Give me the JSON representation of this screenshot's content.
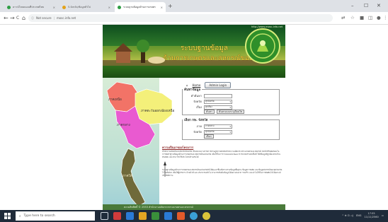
{
  "browser": {
    "tabs": [
      {
        "label": "ดาวน์โหลดแผนที่ประเทศไทย",
        "active": false,
        "color": "#2e9e44"
      },
      {
        "label": "5.จังหวัด/ข้อมูลทั่วไป",
        "active": false,
        "color": "#e3a21a"
      },
      {
        "label": "ระบบฐานข้อมูลด้านการเกษตร",
        "active": true,
        "color": "#2e9e44"
      }
    ],
    "new_tab": "+",
    "window_controls": [
      "–",
      "☐",
      "✕"
    ],
    "nav": {
      "back": "←",
      "forward": "→",
      "reload": "C",
      "home": "⌂"
    },
    "address": {
      "security": "Not secure",
      "url": "mosc.info.net"
    }
  },
  "site": {
    "banner": {
      "top_url": "http://www.mosc-info.net",
      "title_line1": "ระบบฐานข้อมูล",
      "title_line2": "ด้านการเกษตรและสหกรณ์ของจังหวัด"
    },
    "home_link": "Home",
    "admin_button": "Admin Login",
    "search_box": {
      "legend": "ค้นหาข้อมูล",
      "rows": [
        {
          "label": "คำค้นหา",
          "type": "input",
          "value": ""
        },
        {
          "label": "จังหวัด",
          "type": "select",
          "value": "ทุกจังหวัด"
        },
        {
          "label": "เรื่อง",
          "type": "select",
          "value": "ทุกเรื่อง"
        }
      ],
      "search_button": "ค้นหา",
      "advanced_button": "ค้นหาแบบระบุเงื่อนไข"
    },
    "select_box": {
      "legend": "เลือก กษ. จังหวัด",
      "rows": [
        {
          "label": "ภาค",
          "value": "ภาคกลาง"
        },
        {
          "label": "จังหวัด",
          "value": "ทุกจังหวัด"
        }
      ],
      "go_button": "เลือก"
    },
    "news": {
      "title": "ความเป็นมาของโครงการ",
      "paragraph1": "สำนักงานเกษตรและสหกรณ์จังหวัด เป็นหน่วยงานราชการส่วนภูมิภาคสังกัดสำนักงานปลัดกระทรวงเกษตรและสหกรณ์ มีหน้าที่รับผิดชอบในการจัดทำฐานข้อมูลด้านการเกษตรและสหกรณ์ของจังหวัด เพื่อใช้ในการวางแผนและพัฒนาการเกษตรระดับพื้นที่ ให้มีข้อมูลที่ถูกต้องครบถ้วน ทันสมัย และสามารถใช้ประโยชน์ร่วมกันได้",
      "paragraph2": "ระบบฐานข้อมูลด้านการเกษตรและสหกรณ์ของจังหวัดจึงได้พัฒนาขึ้นเพื่อรวบรวมข้อมูลพื้นฐาน ข้อมูลการผลิต และข้อมูลสหกรณ์ของทุกจังหวัดไว้ในที่เดียว เพื่อให้ผู้บริหาร เจ้าหน้าที่ และประชาชนทั่วไป สามารถสืบค้นข้อมูลได้อย่างสะดวก รวดเร็ว และนำไปใช้ในการตัดสินใจได้อย่างมีประสิทธิภาพ"
    },
    "map": {
      "regions": [
        {
          "name": "ภาคเหนือ",
          "color": "#f27367"
        },
        {
          "name": "ภาคตะวันออกเฉียงเหนือ",
          "color": "#f4f07a"
        },
        {
          "name": "ภาคกลาง",
          "color": "#e95ad0"
        },
        {
          "name": "ภาคใต้",
          "color": "#6f6a3a"
        }
      ]
    },
    "footer": "สงวนลิขสิทธิ์ © 2553 สำนักงานปลัดกระทรวงเกษตรและสหกรณ์"
  },
  "taskbar": {
    "search_placeholder": "Type here to search",
    "apps": [
      "#d23b3b",
      "#2a7ad6",
      "#e4a623",
      "#3a8f3a",
      "#2a7ad6",
      "#e25a2a",
      "#3a9fd6",
      "#d9c23a"
    ],
    "tray_icons": "^ ⊕ ⊡ ◁)",
    "language": "ENG",
    "time": "17:55",
    "date": "11/11/2560"
  }
}
